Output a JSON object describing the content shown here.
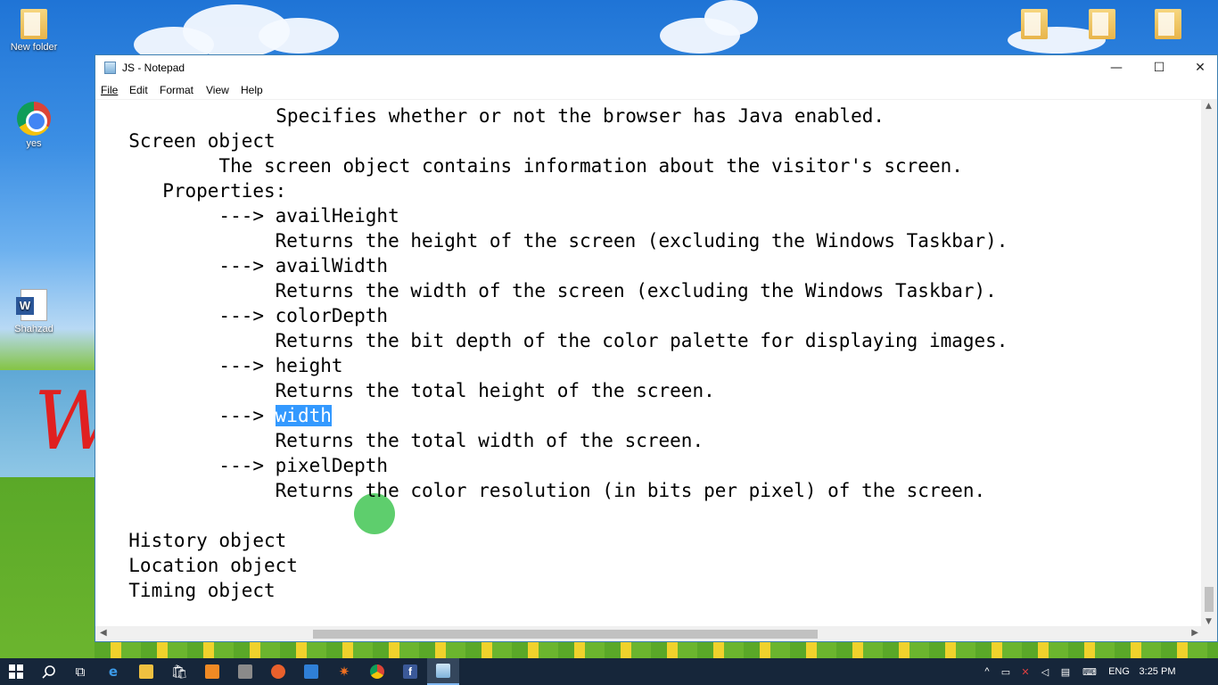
{
  "desktop": {
    "icons": [
      {
        "label": "New folder"
      },
      {
        "label": "yes"
      },
      {
        "label": "Shahzad"
      }
    ]
  },
  "window": {
    "title": "JS - Notepad",
    "controls": {
      "minimize": "—",
      "maximize": "☐",
      "close": "✕"
    }
  },
  "menu": {
    "file": "File",
    "edit": "Edit",
    "format": "Format",
    "view": "View",
    "help": "Help"
  },
  "editor": {
    "lines": [
      "                Specifies whether or not the browser has Java enabled.",
      "  Screen object",
      "          The screen object contains information about the visitor's screen.",
      "     Properties:",
      "          ---> availHeight",
      "               Returns the height of the screen (excluding the Windows Taskbar).",
      "          ---> availWidth",
      "               Returns the width of the screen (excluding the Windows Taskbar).",
      "          ---> colorDepth",
      "               Returns the bit depth of the color palette for displaying images.",
      "          ---> height",
      "               Returns the total height of the screen.",
      "          ---> ",
      "               Returns the total width of the screen.",
      "          ---> pixelDepth",
      "               Returns the color resolution (in bits per pixel) of the screen.",
      "",
      "  History object",
      "  Location object",
      "  Timing object"
    ],
    "selected_word": "width"
  },
  "taskbar": {
    "language": "ENG",
    "time": "3:25 PM"
  },
  "colors": {
    "selection": "#3399ff",
    "taskbar": "#16263a"
  }
}
